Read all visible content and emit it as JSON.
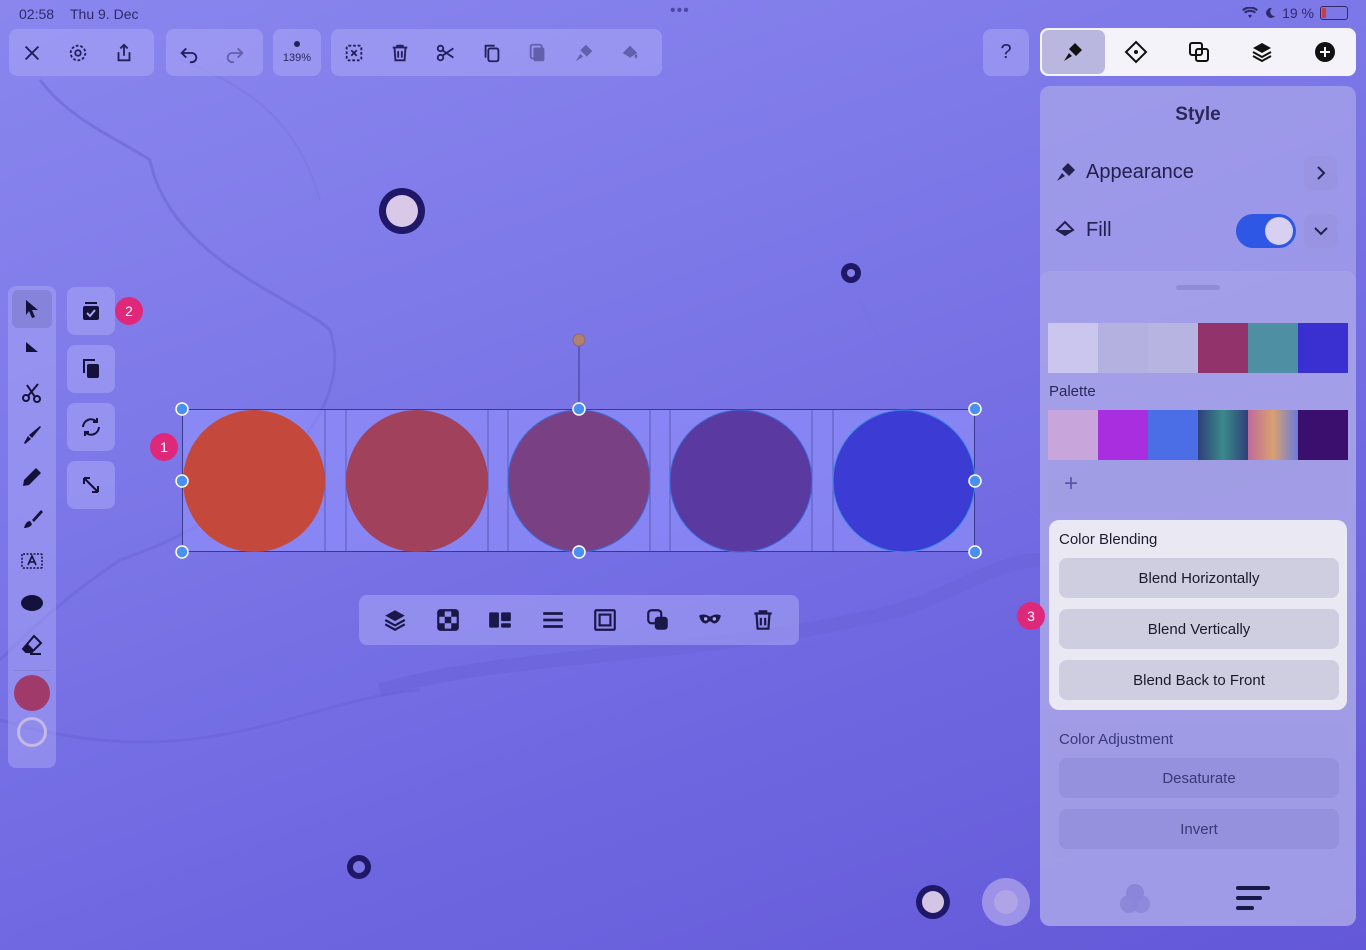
{
  "status_bar": {
    "time": "02:58",
    "date": "Thu 9. Dec",
    "dots": "•••",
    "battery": "19 %"
  },
  "top_toolbar": {
    "zoom": "139%"
  },
  "right_panel": {
    "title": "Style",
    "appearance_label": "Appearance",
    "fill_label": "Fill",
    "fill_enabled": true,
    "palette_label": "Palette",
    "add_label": "+",
    "recent_colors": [
      "#cac6ee",
      "#b4b0e0",
      "#b8b4e2",
      "#93336b",
      "#4f8fa3",
      "#3a30d2"
    ],
    "palette_colors": [
      "#c8a6dc",
      "#a82ee0",
      "#4b6ee6",
      "gradient-teal",
      "gradient-sunset",
      "#3a0f6e"
    ],
    "color_blending": {
      "header": "Color Blending",
      "buttons": [
        "Blend Horizontally",
        "Blend Vertically",
        "Blend Back to Front"
      ]
    },
    "color_adjustment": {
      "header": "Color Adjustment",
      "buttons": [
        "Desaturate",
        "Invert"
      ]
    }
  },
  "badges": {
    "one": "1",
    "two": "2",
    "three": "3"
  },
  "canvas": {
    "shapes": [
      {
        "name": "circle-1",
        "color": "#c4483c"
      },
      {
        "name": "circle-2",
        "color": "#a2415c"
      },
      {
        "name": "circle-3",
        "color": "#7a4084"
      },
      {
        "name": "circle-4",
        "color": "#5a3aa0"
      },
      {
        "name": "circle-5",
        "color": "#3c3bd4"
      }
    ]
  },
  "colors": {
    "accent": "#2f57e6",
    "badge": "#e0287a",
    "current_color": "#a03a6a"
  }
}
